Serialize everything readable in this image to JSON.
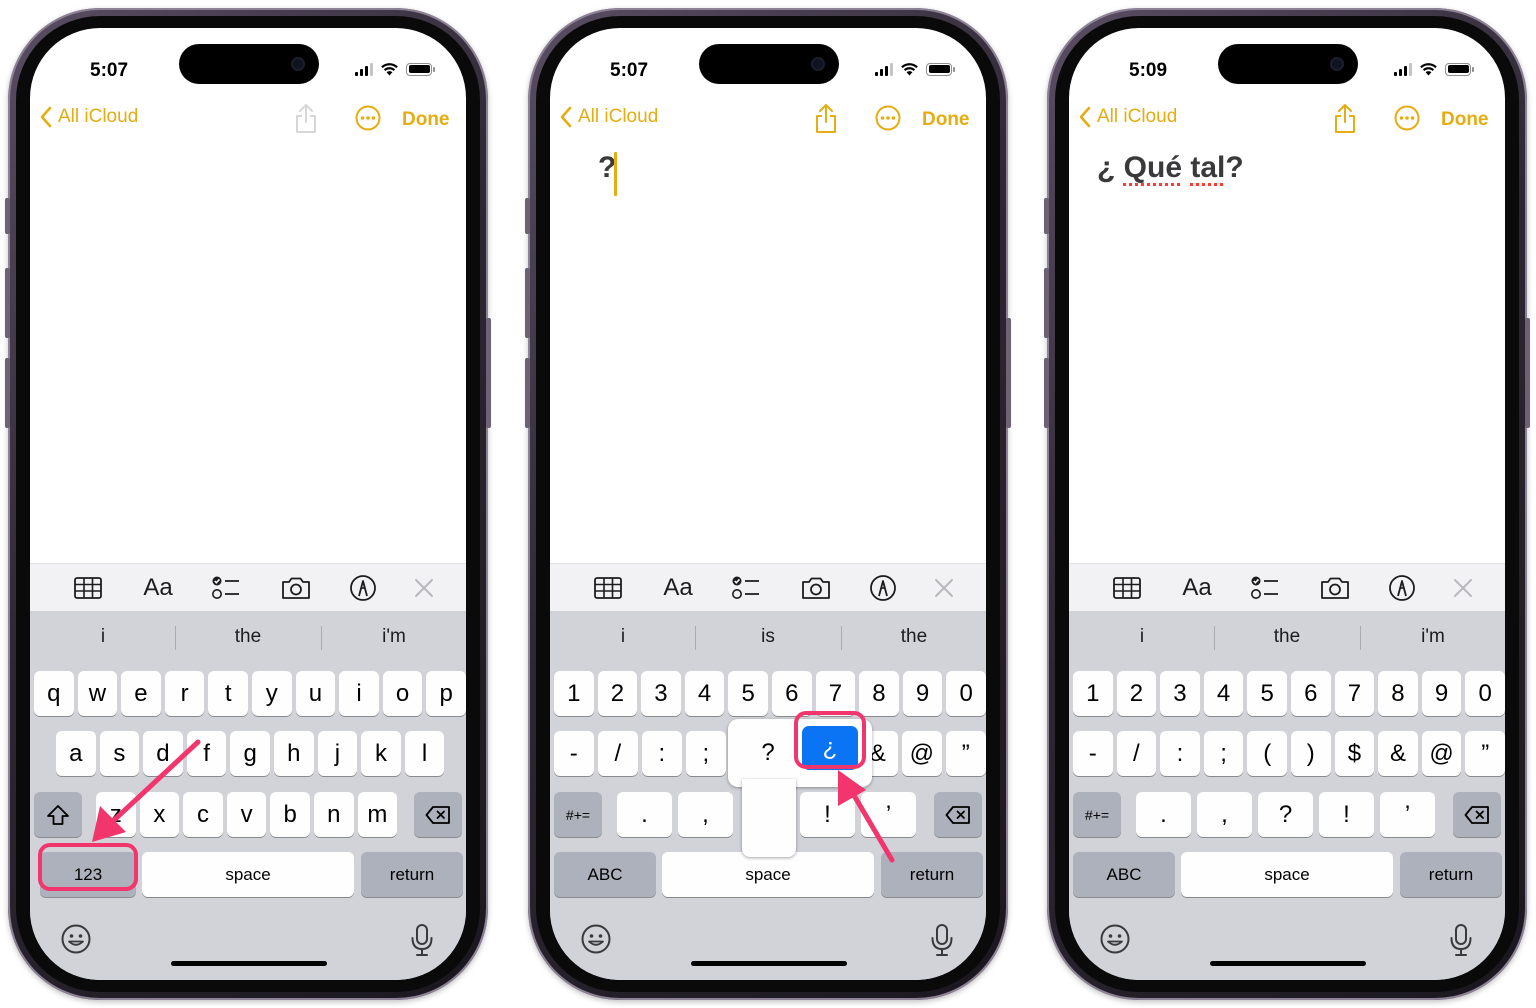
{
  "common": {
    "back_label": "All iCloud",
    "done_label": "Done",
    "format_label": "Aa",
    "space_label": "space",
    "return_label": "return",
    "accent": "#e5ad12",
    "highlight": "#f2366d"
  },
  "phones": [
    {
      "time": "5:07",
      "note_text": "",
      "suggestions": [
        "i",
        "the",
        "i'm"
      ],
      "row1": [
        "q",
        "w",
        "e",
        "r",
        "t",
        "y",
        "u",
        "i",
        "o",
        "p"
      ],
      "row2": [
        "a",
        "s",
        "d",
        "f",
        "g",
        "h",
        "j",
        "k",
        "l"
      ],
      "row3": [
        "z",
        "x",
        "c",
        "v",
        "b",
        "n",
        "m"
      ],
      "mode_key": "123"
    },
    {
      "time": "5:07",
      "note_text": "?",
      "suggestions": [
        "i",
        "is",
        "the"
      ],
      "row1": [
        "1",
        "2",
        "3",
        "4",
        "5",
        "6",
        "7",
        "8",
        "9",
        "0"
      ],
      "row2": [
        "-",
        "/",
        ":",
        ";",
        "&",
        "@",
        "”"
      ],
      "row3": [
        ".",
        ",",
        "!",
        "’"
      ],
      "shift_key": "#+=",
      "mode_key": "ABC",
      "popup_options": [
        "?",
        "¿"
      ]
    },
    {
      "time": "5:09",
      "note_text_plain": "¿ ",
      "note_text_word1": "Qué",
      "note_text_word2": "tal",
      "note_text_end": "?",
      "suggestions": [
        "i",
        "the",
        "i'm"
      ],
      "row1": [
        "1",
        "2",
        "3",
        "4",
        "5",
        "6",
        "7",
        "8",
        "9",
        "0"
      ],
      "row2": [
        "-",
        "/",
        ":",
        ";",
        "(",
        ")",
        "$",
        "&",
        "@",
        "”"
      ],
      "row3": [
        ".",
        ",",
        "?",
        "!",
        "’"
      ],
      "shift_key": "#+=",
      "mode_key": "ABC"
    }
  ]
}
